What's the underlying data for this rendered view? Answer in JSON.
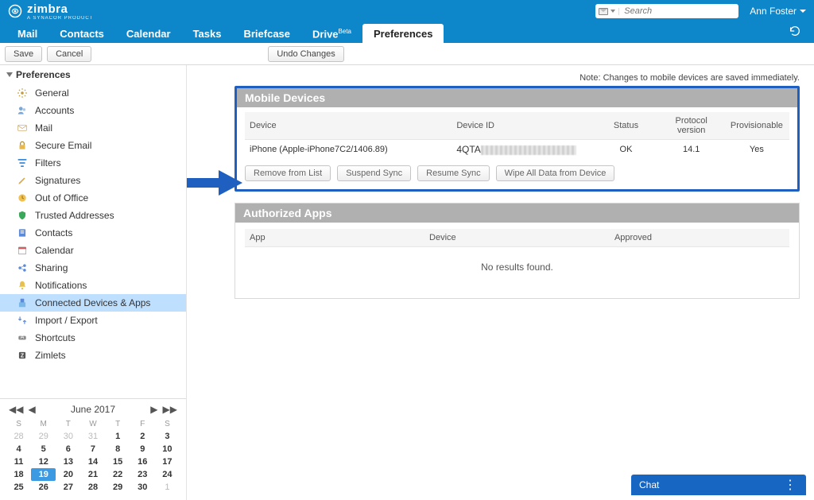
{
  "brand": {
    "name": "zimbra",
    "tagline": "A SYNACOR PRODUCT"
  },
  "search": {
    "placeholder": "Search"
  },
  "user": {
    "name": "Ann Foster"
  },
  "tabs": [
    "Mail",
    "Contacts",
    "Calendar",
    "Tasks",
    "Briefcase",
    "Drive",
    "Preferences"
  ],
  "drive_suffix": "Beta",
  "active_tab": "Preferences",
  "toolbar": {
    "save": "Save",
    "cancel": "Cancel",
    "undo": "Undo Changes"
  },
  "sidebar": {
    "header": "Preferences",
    "items": [
      {
        "label": "General",
        "icon": "gear"
      },
      {
        "label": "Accounts",
        "icon": "accounts"
      },
      {
        "label": "Mail",
        "icon": "mail"
      },
      {
        "label": "Secure Email",
        "icon": "lock"
      },
      {
        "label": "Filters",
        "icon": "filters"
      },
      {
        "label": "Signatures",
        "icon": "pen"
      },
      {
        "label": "Out of Office",
        "icon": "away"
      },
      {
        "label": "Trusted Addresses",
        "icon": "shield"
      },
      {
        "label": "Contacts",
        "icon": "contacts"
      },
      {
        "label": "Calendar",
        "icon": "calendar"
      },
      {
        "label": "Sharing",
        "icon": "share"
      },
      {
        "label": "Notifications",
        "icon": "bell"
      },
      {
        "label": "Connected Devices & Apps",
        "icon": "device",
        "selected": true
      },
      {
        "label": "Import / Export",
        "icon": "importexport"
      },
      {
        "label": "Shortcuts",
        "icon": "key"
      },
      {
        "label": "Zimlets",
        "icon": "zimlet"
      }
    ]
  },
  "content": {
    "note": "Note: Changes to mobile devices are saved immediately.",
    "mobile": {
      "title": "Mobile Devices",
      "columns": [
        "Device",
        "Device ID",
        "Status",
        "Protocol version",
        "Provisionable"
      ],
      "row": {
        "device": "iPhone (Apple-iPhone7C2/1406.89)",
        "id_visible": "4QTA",
        "status": "OK",
        "protocol": "14.1",
        "provisionable": "Yes"
      },
      "actions": [
        "Remove from List",
        "Suspend Sync",
        "Resume Sync",
        "Wipe All Data from Device"
      ]
    },
    "apps": {
      "title": "Authorized Apps",
      "columns": [
        "App",
        "Device",
        "Approved"
      ],
      "empty": "No results found."
    }
  },
  "calendar": {
    "title": "June 2017",
    "dow": [
      "S",
      "M",
      "T",
      "W",
      "T",
      "F",
      "S"
    ],
    "weeks": [
      [
        {
          "d": 28,
          "o": true
        },
        {
          "d": 29,
          "o": true
        },
        {
          "d": 30,
          "o": true
        },
        {
          "d": 31,
          "o": true
        },
        {
          "d": 1
        },
        {
          "d": 2
        },
        {
          "d": 3
        }
      ],
      [
        {
          "d": 4
        },
        {
          "d": 5
        },
        {
          "d": 6
        },
        {
          "d": 7
        },
        {
          "d": 8
        },
        {
          "d": 9
        },
        {
          "d": 10
        }
      ],
      [
        {
          "d": 11
        },
        {
          "d": 12
        },
        {
          "d": 13
        },
        {
          "d": 14
        },
        {
          "d": 15
        },
        {
          "d": 16
        },
        {
          "d": 17
        }
      ],
      [
        {
          "d": 18
        },
        {
          "d": 19,
          "today": true
        },
        {
          "d": 20
        },
        {
          "d": 21
        },
        {
          "d": 22
        },
        {
          "d": 23
        },
        {
          "d": 24
        }
      ],
      [
        {
          "d": 25
        },
        {
          "d": 26
        },
        {
          "d": 27
        },
        {
          "d": 28
        },
        {
          "d": 29
        },
        {
          "d": 30
        },
        {
          "d": 1,
          "o": true
        }
      ]
    ]
  },
  "chat": {
    "label": "Chat"
  }
}
